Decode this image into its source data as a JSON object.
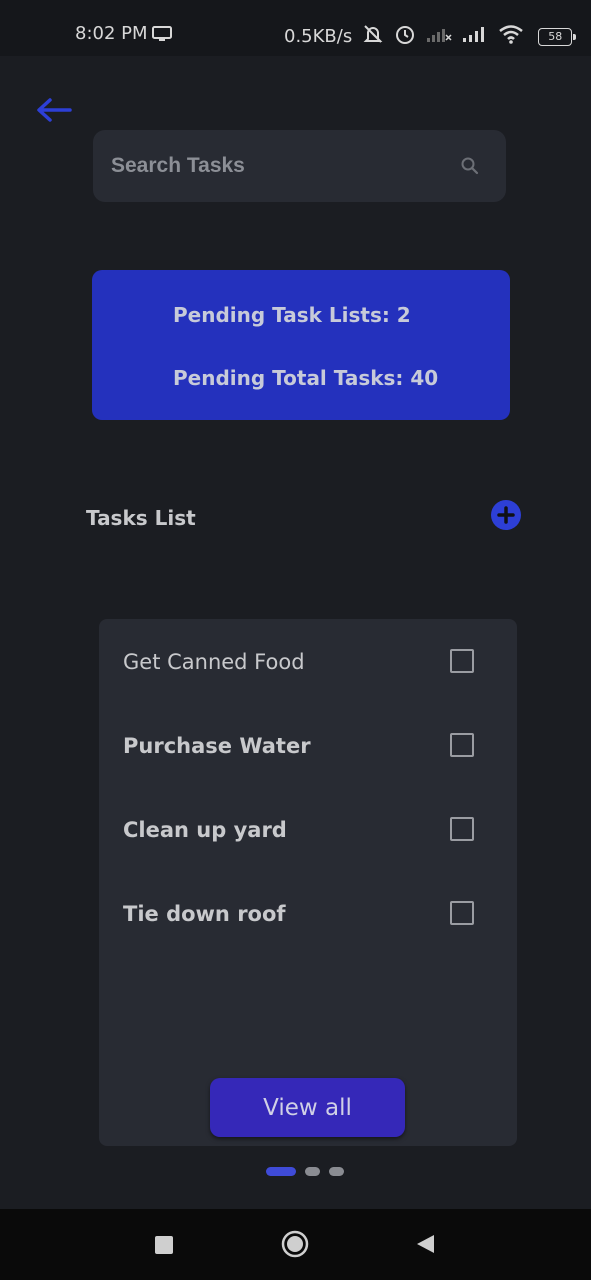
{
  "status_bar": {
    "time": "8:02 PM",
    "network_speed": "0.5KB/s",
    "battery": "58",
    "icons": [
      "screen-icon",
      "mute-bell-icon",
      "alarm-icon",
      "signal-icon",
      "signal-icon",
      "wifi-icon",
      "battery-icon"
    ]
  },
  "header": {
    "back_icon": "arrow-left-icon"
  },
  "search": {
    "placeholder": "Search Tasks",
    "value": "",
    "icon": "search-icon"
  },
  "summary": {
    "pending_task_lists": "Pending Task Lists: 2",
    "pending_total_tasks": "Pending Total Tasks:  40"
  },
  "tasks_section": {
    "title": "Tasks List",
    "add_icon": "plus-circle-icon"
  },
  "task_card": {
    "items": [
      {
        "label": "Get Canned Food",
        "checked": false
      },
      {
        "label": "Purchase Water",
        "checked": false
      },
      {
        "label": "Clean up yard",
        "checked": false
      },
      {
        "label": "Tie down roof",
        "checked": false
      }
    ],
    "view_all_label": "View all"
  },
  "pager": {
    "total": 3,
    "active": 1
  },
  "colors": {
    "accent": "#2431bd",
    "button": "#3528b8",
    "background": "#1b1d22",
    "card": "#282b33"
  },
  "nav_bar": {
    "icons": [
      "recent-apps-icon",
      "home-icon",
      "back-icon"
    ]
  }
}
